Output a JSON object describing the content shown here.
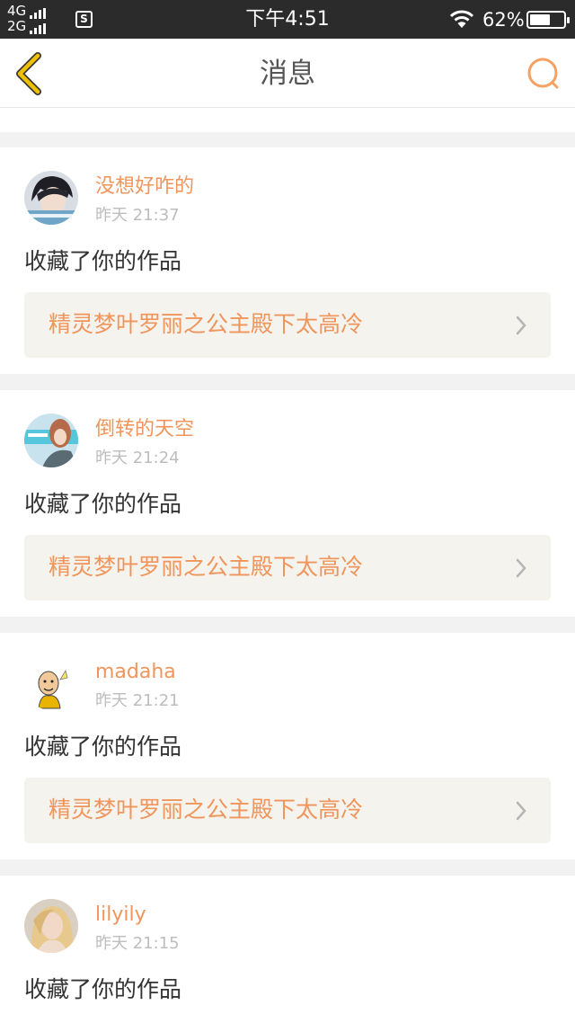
{
  "status_bar": {
    "network_top": "4G",
    "network_bottom": "2G",
    "sim_badge": "S",
    "time": "下午4:51",
    "battery_percent": "62%",
    "battery_level": 0.62
  },
  "nav": {
    "title": "消息",
    "back_icon": "chevron-left-icon",
    "search_icon": "search-icon"
  },
  "theme": {
    "accent": "#f0955b",
    "back_icon_color": "#f0c000",
    "search_icon_color": "#f5a161"
  },
  "notifications": [
    {
      "username": "没想好咋的",
      "timestamp": "昨天 21:37",
      "action": "收藏了你的作品",
      "work_title": "精灵梦叶罗丽之公主殿下太高冷"
    },
    {
      "username": "倒转的天空",
      "timestamp": "昨天 21:24",
      "action": "收藏了你的作品",
      "work_title": "精灵梦叶罗丽之公主殿下太高冷"
    },
    {
      "username": "madaha",
      "timestamp": "昨天 21:21",
      "action": "收藏了你的作品",
      "work_title": "精灵梦叶罗丽之公主殿下太高冷"
    },
    {
      "username": "lilyily",
      "timestamp": "昨天 21:15",
      "action": "收藏了你的作品"
    }
  ]
}
